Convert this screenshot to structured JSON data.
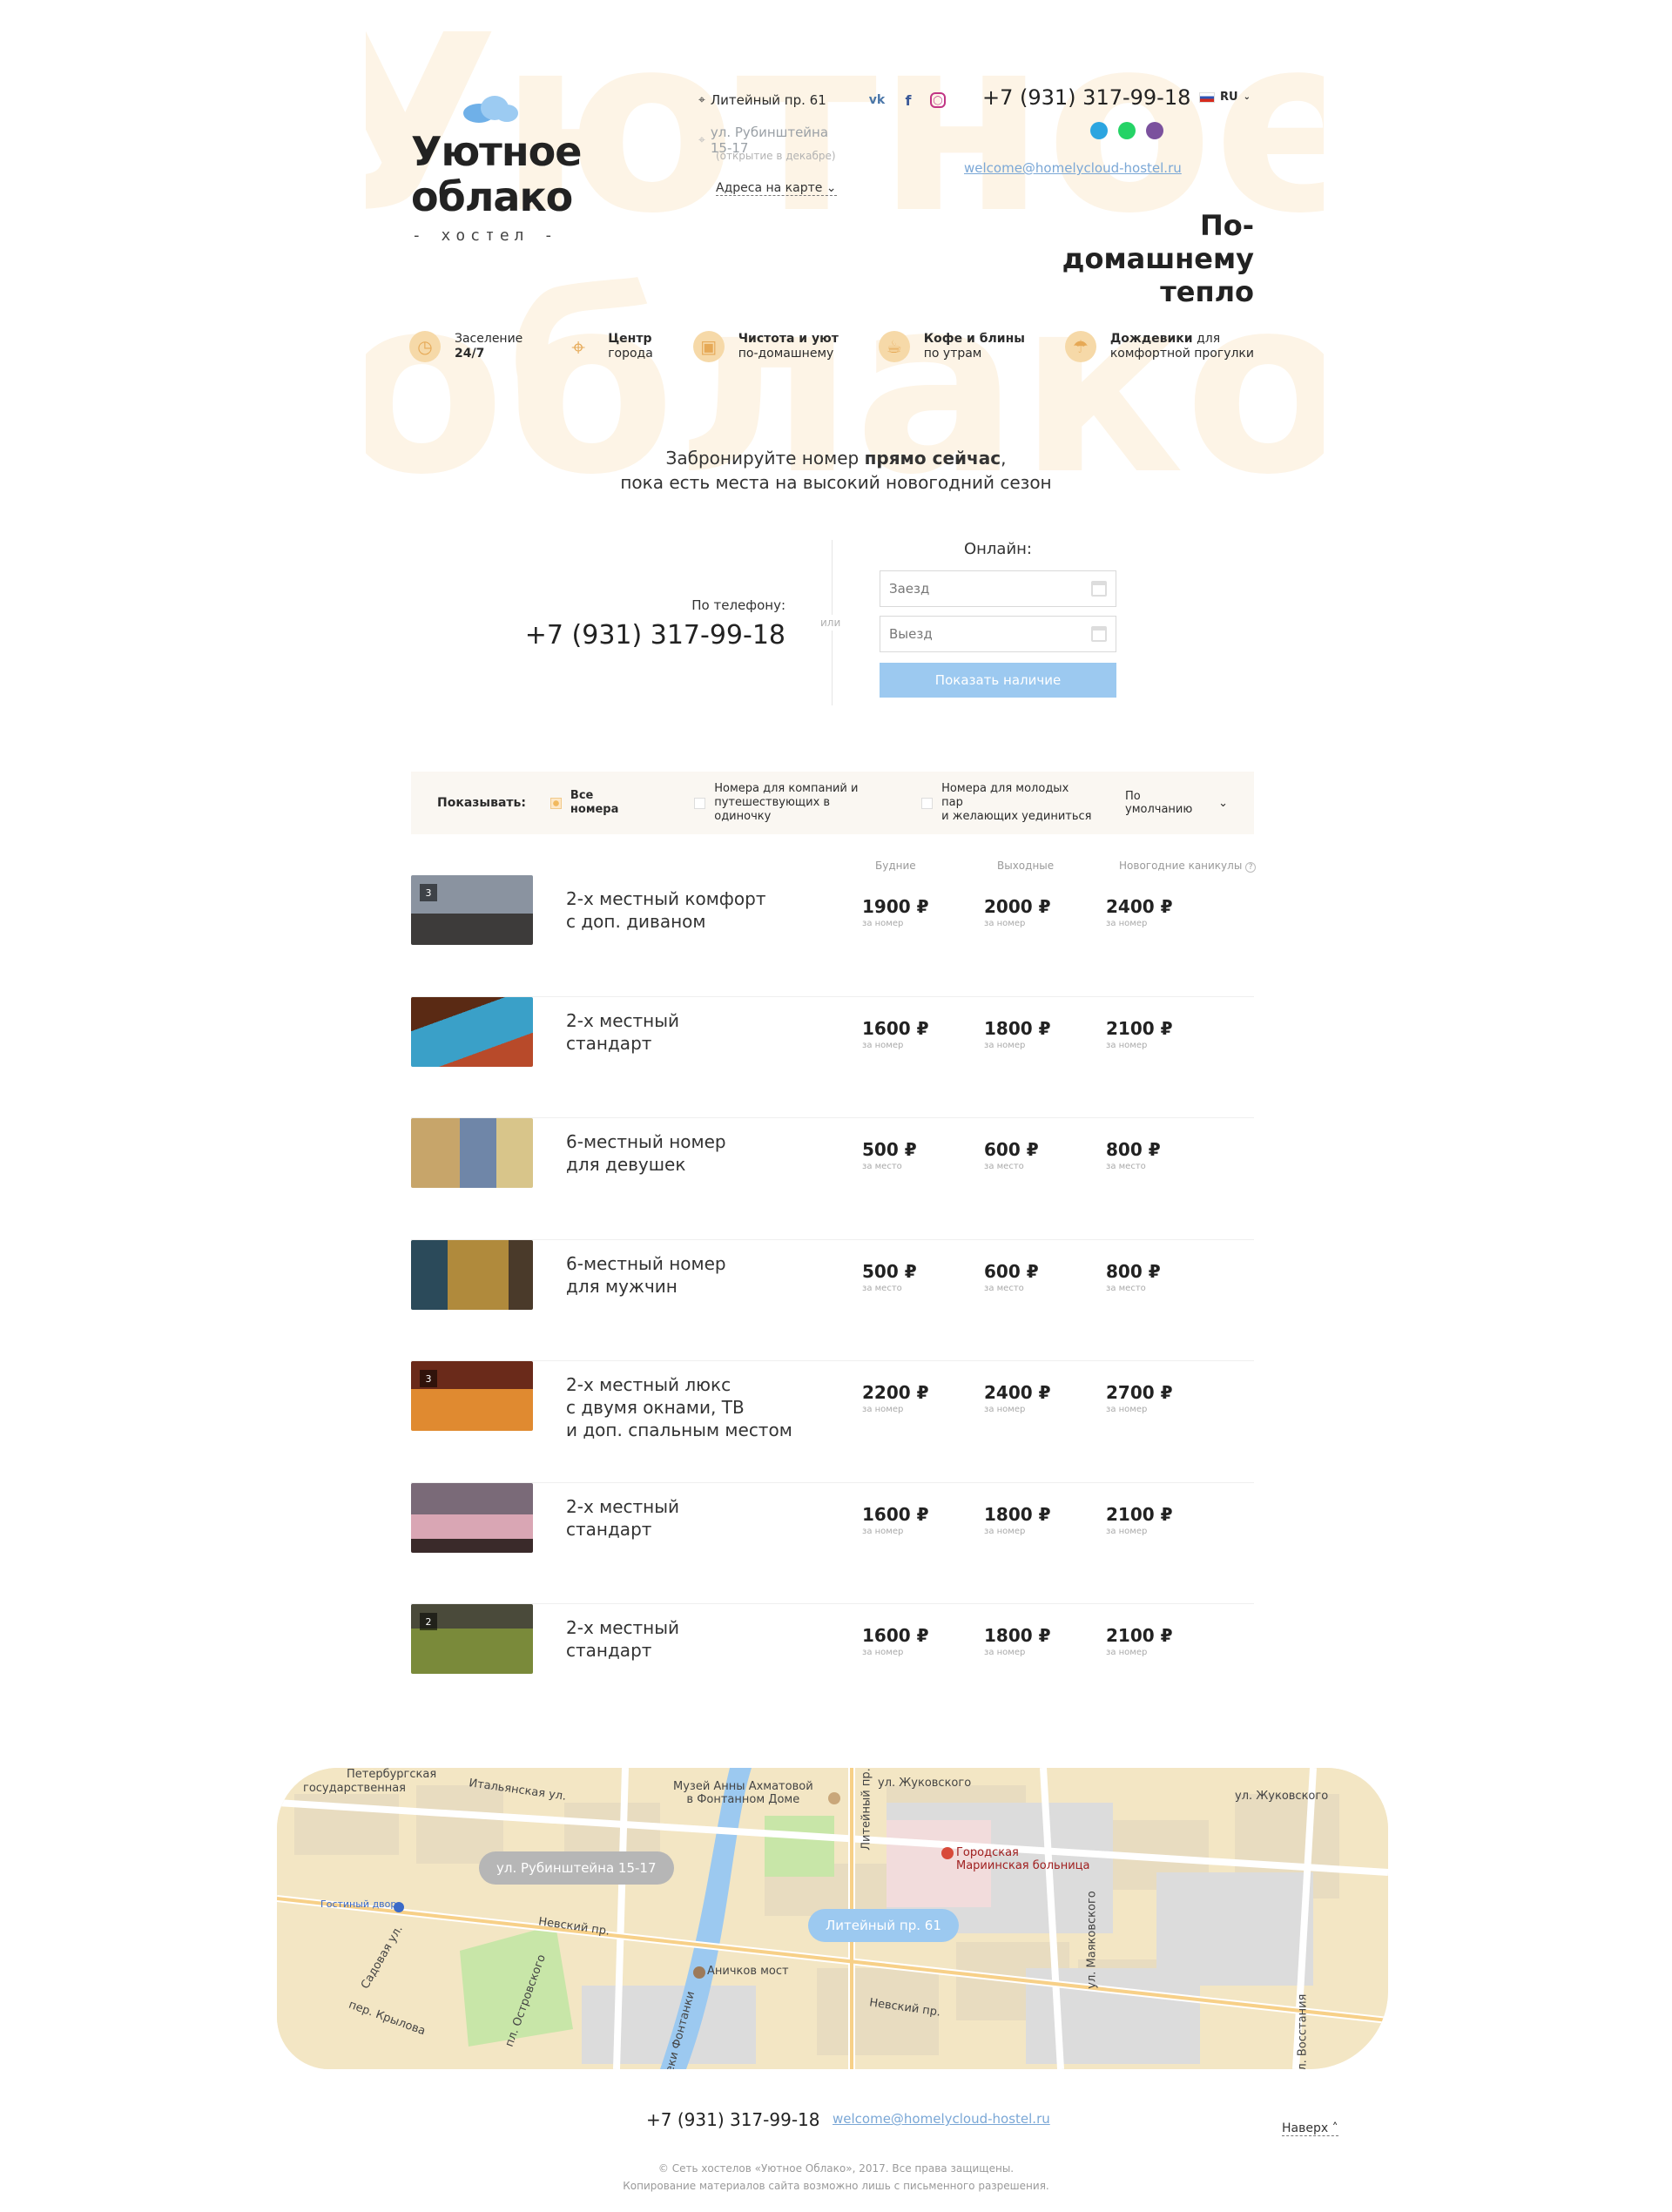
{
  "header": {
    "logo_line1": "Уютное",
    "logo_line2": "облако",
    "logo_sub": "- хостел -",
    "address_primary": "Литейный пр. 61",
    "address_secondary": "ул. Рубинштейна 15-17",
    "address_secondary_note": "(открытие в декабре)",
    "map_link": "Адреса на карте",
    "phone": "+7 (931) 317-99-18",
    "email": "welcome@homelycloud-hostel.ru",
    "lang": "RU",
    "slogan_line1": "По-домашнему",
    "slogan_line2": "тепло",
    "watermark_line1": "Уютное",
    "watermark_line2": "облако",
    "social_icons": [
      "vk-icon",
      "facebook-icon",
      "instagram-icon"
    ],
    "messenger_icons": [
      "telegram-icon",
      "whatsapp-icon",
      "viber-icon"
    ],
    "accent": "#f6d9a8"
  },
  "features": [
    {
      "title": "Заселение",
      "sub": "24/7",
      "icon": "clock-icon"
    },
    {
      "title": "Центр",
      "sub": "города",
      "icon": "location-pin-icon"
    },
    {
      "title": "Чистота и уют",
      "sub": "по-домашнему",
      "icon": "armchair-icon"
    },
    {
      "title": "Кофе и блины",
      "sub": "по утрам",
      "icon": "coffee-cup-icon"
    },
    {
      "title": "Дождевики",
      "title_rest": " для",
      "sub": "комфортной прогулки",
      "icon": "raincoat-icon"
    }
  ],
  "booking": {
    "lead_part1": "Забронируйте номер ",
    "lead_bold": "прямо сейчас",
    "lead_part2": ",",
    "lead_line2": "пока есть места на высокий новогодний сезон",
    "phone_label": "По телефону:",
    "phone": "+7 (931) 317-99-18",
    "or": "или",
    "online_label": "Онлайн:",
    "checkin_placeholder": "Заезд",
    "checkout_placeholder": "Выезд",
    "check_button": "Показать наличие",
    "button_color": "#9cc9f0"
  },
  "filter": {
    "show_label": "Показывать:",
    "options": [
      {
        "label": "Все номера",
        "checked": true
      },
      {
        "label": "Номера для компаний и\nпутешествующих в одиночку",
        "checked": false
      },
      {
        "label": "Номера для молодых пар\nи желающих уединиться",
        "checked": false
      }
    ],
    "sort": "По умолчанию"
  },
  "price_headers": [
    "Будние",
    "Выходные",
    "Новогодние каникулы"
  ],
  "rooms": [
    {
      "name": "2-х местный комфорт\nс доп. диваном",
      "badge": "3",
      "prices": [
        "1900 ₽",
        "2000 ₽",
        "2400 ₽"
      ],
      "unit": "за номер"
    },
    {
      "name": "2-х местный\nстандарт",
      "badge": "",
      "prices": [
        "1600 ₽",
        "1800 ₽",
        "2100 ₽"
      ],
      "unit": "за номер"
    },
    {
      "name": "6-местный номер\nдля девушек",
      "badge": "",
      "prices": [
        "500 ₽",
        "600 ₽",
        "800 ₽"
      ],
      "unit": "за место"
    },
    {
      "name": "6-местный номер\nдля мужчин",
      "badge": "",
      "prices": [
        "500 ₽",
        "600 ₽",
        "800 ₽"
      ],
      "unit": "за место"
    },
    {
      "name": "2-х местный люкс\nс двумя окнами, ТВ\nи доп. спальным местом",
      "badge": "3",
      "prices": [
        "2200 ₽",
        "2400 ₽",
        "2700 ₽"
      ],
      "unit": "за номер"
    },
    {
      "name": "2-х местный\nстандарт",
      "badge": "",
      "prices": [
        "1600 ₽",
        "1800 ₽",
        "2100 ₽"
      ],
      "unit": "за номер"
    },
    {
      "name": "2-х местный\nстандарт",
      "badge": "2",
      "prices": [
        "1600 ₽",
        "1800 ₽",
        "2100 ₽"
      ],
      "unit": "за номер"
    }
  ],
  "map": {
    "marker_rubinstein": "ул. Рубинштейна 15-17",
    "marker_liteyny": "Литейный пр. 61",
    "labels": {
      "museum": "Музей Анны Ахматовой\nв Фонтанном Доме",
      "hospital": "Городская\nМариинская больница",
      "anichkov": "Аничков мост",
      "nevsky1": "Невский пр.",
      "nevsky2": "Невский пр.",
      "zhukovskogo1": "ул. Жуковского",
      "zhukovskogo2": "ул. Жуковского",
      "gostiny": "Гостиный двор",
      "italyanskaya": "Итальянская ул.",
      "liteyny": "Литейный пр.",
      "mayakovskogo": "ул. Маяковского",
      "vosstaniya": "ул. Восстания",
      "sadovaya": "Садовая ул.",
      "krylova": "пер. Крылова",
      "ostrovskogo": "пл. Островского",
      "fontanka": "реки Фонтанки",
      "gos": "государственная",
      "peterb": "Петербургская"
    }
  },
  "footer": {
    "phone": "+7 (931) 317-99-18",
    "email": "welcome@homelycloud-hostel.ru",
    "to_top": "Наверх",
    "copyright": "© Сеть хостелов «Уютное Облако», 2017. Все права защищены.",
    "copy_note": "Копирование материалов сайта возможно лишь с письменного разрешения."
  }
}
